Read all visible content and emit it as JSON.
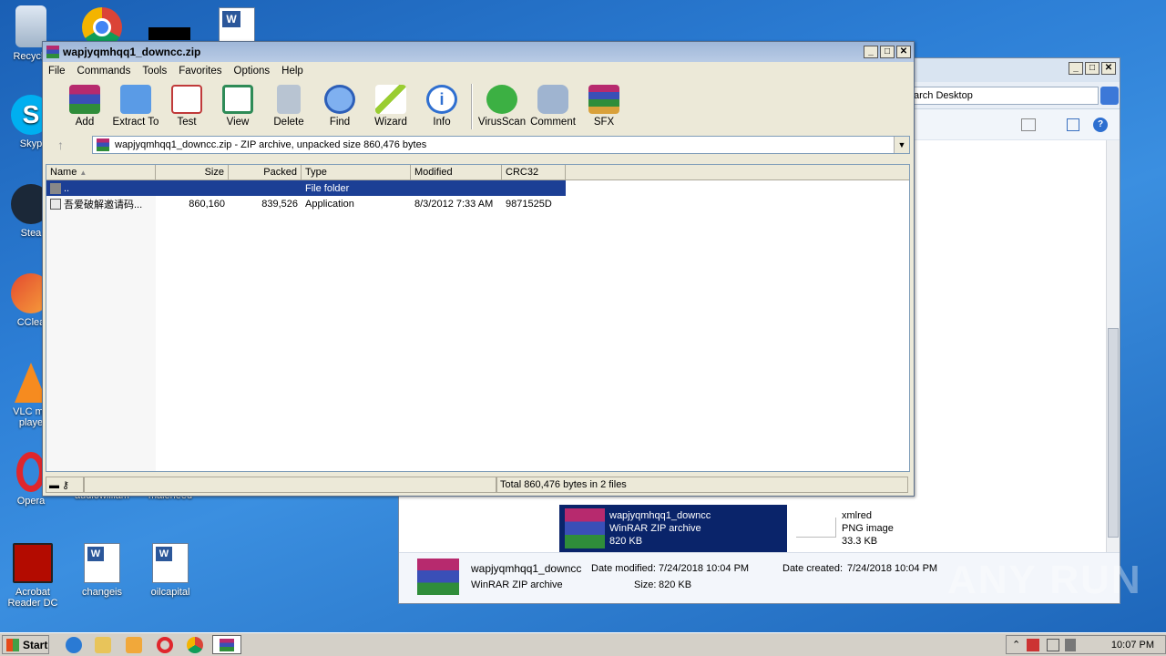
{
  "desktop": {
    "icons": [
      {
        "label": "Recycle"
      },
      {
        "label": "Skyp"
      },
      {
        "label": "Stea"
      },
      {
        "label": "CClea"
      },
      {
        "label": "VLC me playe"
      },
      {
        "label": "Opera"
      },
      {
        "label": "audiowilliam"
      },
      {
        "label": "maleneed"
      },
      {
        "label": "Acrobat Reader DC"
      },
      {
        "label": "changeis"
      },
      {
        "label": "oilcapital"
      }
    ]
  },
  "explorer": {
    "search_text": "arch Desktop",
    "selected_item": {
      "name": "wapjyqmhqq1_downcc",
      "type": "WinRAR ZIP archive",
      "size": "820 KB"
    },
    "other_item": {
      "name": "xmlred",
      "type": "PNG image",
      "size": "33.3 KB"
    },
    "details": {
      "name": "wapjyqmhqq1_downcc",
      "type": "WinRAR ZIP archive",
      "modified_label": "Date modified:",
      "modified": "7/24/2018 10:04 PM",
      "created_label": "Date created:",
      "created": "7/24/2018 10:04 PM",
      "size_label": "Size:",
      "size": "820 KB"
    }
  },
  "winrar": {
    "title": "wapjyqmhqq1_downcc.zip",
    "menu": [
      "File",
      "Commands",
      "Tools",
      "Favorites",
      "Options",
      "Help"
    ],
    "tools": [
      {
        "label": "Add",
        "icon": "add-icon",
        "color": "#c0392b"
      },
      {
        "label": "Extract To",
        "icon": "folder-icon",
        "color": "#3a7bd5"
      },
      {
        "label": "Test",
        "icon": "test-icon",
        "color": "#d35454"
      },
      {
        "label": "View",
        "icon": "book-icon",
        "color": "#2e8b57"
      },
      {
        "label": "Delete",
        "icon": "trash-icon",
        "color": "#8a9bb0"
      },
      {
        "label": "Find",
        "icon": "magnifier-icon",
        "color": "#3b6fd0"
      },
      {
        "label": "Wizard",
        "icon": "wand-icon",
        "color": "#9acd32"
      },
      {
        "label": "Info",
        "icon": "info-icon",
        "color": "#2f6fd0"
      },
      {
        "label": "VirusScan",
        "icon": "bug-icon",
        "color": "#3cb043"
      },
      {
        "label": "Comment",
        "icon": "comment-icon",
        "color": "#6f8fb8"
      },
      {
        "label": "SFX",
        "icon": "sfx-icon",
        "color": "#d9a13b"
      }
    ],
    "path": "wapjyqmhqq1_downcc.zip - ZIP archive, unpacked size 860,476 bytes",
    "columns": [
      "Name",
      "Size",
      "Packed",
      "Type",
      "Modified",
      "CRC32"
    ],
    "rows": [
      {
        "name": "..",
        "size": "",
        "packed": "",
        "type": "File folder",
        "modified": "",
        "crc": ""
      },
      {
        "name": "吾爱破解邀请码...",
        "size": "860,160",
        "packed": "839,526",
        "type": "Application",
        "modified": "8/3/2012 7:33 AM",
        "crc": "9871525D"
      }
    ],
    "status": "Total 860,476 bytes in 2 files"
  },
  "taskbar": {
    "start": "Start",
    "clock": "10:07 PM"
  },
  "watermark": "ANY RUN"
}
